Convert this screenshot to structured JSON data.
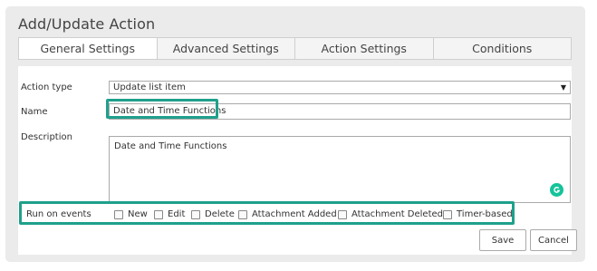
{
  "dialog": {
    "title": "Add/Update Action"
  },
  "tabs": [
    {
      "label": "General Settings",
      "active": true
    },
    {
      "label": "Advanced Settings"
    },
    {
      "label": "Action Settings"
    },
    {
      "label": "Conditions"
    }
  ],
  "form": {
    "action_type_label": "Action type",
    "action_type_value": "Update list item",
    "name_label": "Name",
    "name_value": "Date and Time Functions",
    "description_label": "Description",
    "description_value": "Date and Time Functions",
    "run_on_events_label": "Run on events",
    "events": [
      {
        "label": "New",
        "checked": false
      },
      {
        "label": "Edit",
        "checked": false
      },
      {
        "label": "Delete",
        "checked": false
      },
      {
        "label": "Attachment Added",
        "checked": false
      },
      {
        "label": "Attachment Deleted",
        "checked": false
      },
      {
        "label": "Timer-based",
        "checked": false
      }
    ]
  },
  "buttons": {
    "save": "Save",
    "cancel": "Cancel"
  },
  "colors": {
    "highlight": "#1fa08c",
    "grammarly": "#15c39a"
  }
}
